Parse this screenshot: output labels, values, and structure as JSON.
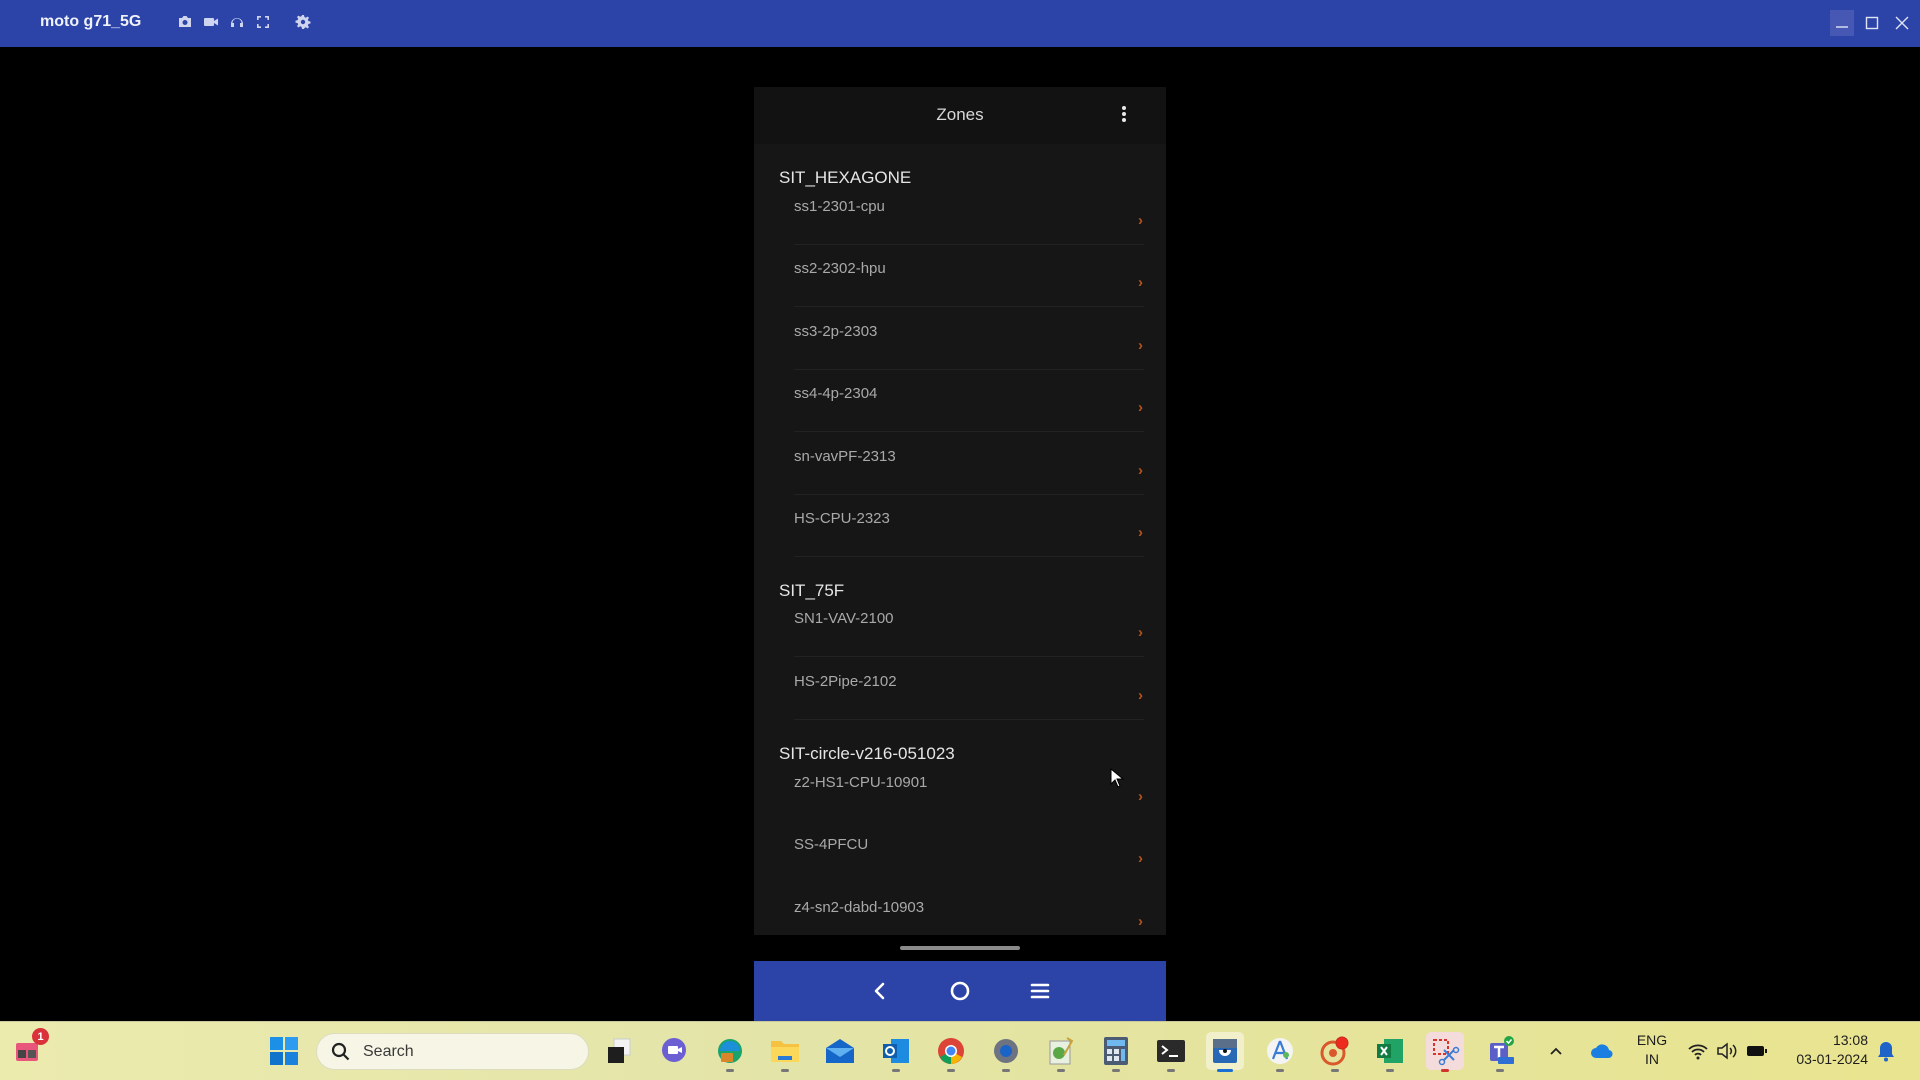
{
  "window": {
    "title": "moto g71_5G",
    "tools": [
      "camera-icon",
      "video-icon",
      "headphones-icon",
      "fullscreen-icon",
      "settings-icon"
    ],
    "controls": [
      "minimize",
      "maximize",
      "close"
    ]
  },
  "phone": {
    "appbar": {
      "title": "Zones",
      "menu_icon": "more-vertical-icon"
    },
    "groups": [
      {
        "name": "SIT_HEXAGONE",
        "items": [
          "ss1-2301-cpu",
          "ss2-2302-hpu",
          "ss3-2p-2303",
          "ss4-4p-2304",
          "sn-vavPF-2313",
          "HS-CPU-2323"
        ]
      },
      {
        "name": "SIT_75F",
        "items": [
          "SN1-VAV-2100",
          "HS-2Pipe-2102"
        ]
      },
      {
        "name": "SIT-circle-v216-051023",
        "items": [
          "z2-HS1-CPU-10901",
          "SS-4PFCU",
          "z4-sn2-dabd-10903"
        ]
      }
    ],
    "chevron": "›",
    "accent_color": "#b4541e",
    "navbar": [
      "back",
      "home",
      "menu"
    ]
  },
  "taskbar": {
    "widgets_badge": "1",
    "search_placeholder": "Search",
    "apps": [
      "task-view",
      "meet",
      "edge",
      "file-explorer",
      "mail",
      "outlook",
      "chrome",
      "settings",
      "notepad",
      "calculator",
      "terminal",
      "scrcpy",
      "android-studio",
      "screen-recorder",
      "excel",
      "snipping-tool",
      "teams"
    ],
    "tray": {
      "language_line1": "ENG",
      "language_line2": "IN",
      "time": "13:08",
      "date": "03-01-2024"
    }
  }
}
